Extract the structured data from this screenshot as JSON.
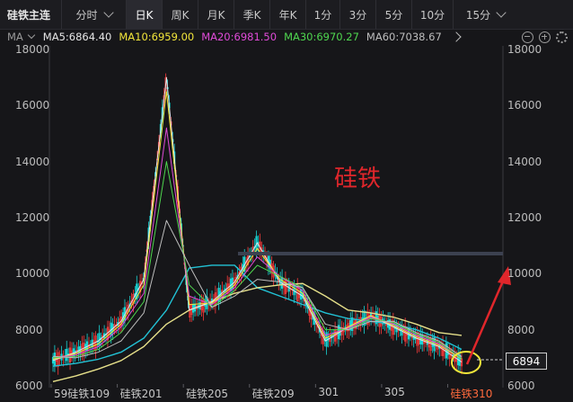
{
  "toolbar": {
    "title": "硅铁主连",
    "tabs": [
      "分时",
      "日K",
      "周K",
      "月K",
      "季K",
      "年K",
      "1分",
      "3分",
      "5分",
      "10分",
      "15分"
    ],
    "active_tab": "日K"
  },
  "ma_bar": {
    "label": "MA",
    "items": [
      {
        "text": "MA5:6864.40",
        "color": "#e6e6e6"
      },
      {
        "text": "MA10:6959.00",
        "color": "#f2e63a"
      },
      {
        "text": "MA20:6981.50",
        "color": "#e04bd8"
      },
      {
        "text": "MA30:6970.27",
        "color": "#4fd64f"
      },
      {
        "text": "MA60:7038.67",
        "color": "#bdbdbd"
      }
    ]
  },
  "y_axis": {
    "ticks": [
      "18000",
      "16000",
      "14000",
      "12000",
      "10000",
      "8000",
      "6000"
    ]
  },
  "x_axis": {
    "labels": [
      {
        "text": "59硅铁109",
        "color": "#c8c8c8"
      },
      {
        "text": "硅铁201",
        "color": "#c8c8c8"
      },
      {
        "text": "硅铁205",
        "color": "#c8c8c8"
      },
      {
        "text": "硅铁209",
        "color": "#c8c8c8"
      },
      {
        "text": "301",
        "color": "#c8c8c8"
      },
      {
        "text": "305",
        "color": "#c8c8c8"
      },
      {
        "text": "硅铁310",
        "color": "#ff6a3d"
      }
    ]
  },
  "current_price": "6894",
  "annotation": "硅铁",
  "chart_data": {
    "type": "line",
    "ylim": [
      6000,
      18000
    ],
    "series": [
      {
        "name": "MA5",
        "color": "#e6e6e6",
        "values": [
          6900,
          7200,
          7600,
          8300,
          9800,
          17000,
          8700,
          9000,
          9700,
          11100,
          9700,
          9200,
          7600,
          8100,
          8500,
          8100,
          7700,
          7400,
          6850
        ]
      },
      {
        "name": "MA10",
        "color": "#f2e63a",
        "values": [
          6950,
          7150,
          7500,
          8200,
          9600,
          16500,
          8900,
          8950,
          9600,
          10900,
          9800,
          9300,
          7700,
          8100,
          8500,
          8150,
          7750,
          7450,
          6960
        ]
      },
      {
        "name": "MA20",
        "color": "#e04bd8",
        "values": [
          7000,
          7100,
          7400,
          8100,
          9300,
          15200,
          9200,
          8900,
          9500,
          10600,
          9900,
          9400,
          7800,
          8050,
          8450,
          8200,
          7800,
          7500,
          6980
        ]
      },
      {
        "name": "MA30",
        "color": "#4fd64f",
        "values": [
          7000,
          7050,
          7300,
          7900,
          9000,
          14000,
          9600,
          8800,
          9400,
          10300,
          9900,
          9500,
          8000,
          8000,
          8400,
          8250,
          7850,
          7550,
          6970
        ]
      },
      {
        "name": "MA60",
        "color": "#bdbdbd",
        "values": [
          7050,
          7000,
          7200,
          7600,
          8600,
          11900,
          10300,
          8800,
          9200,
          9800,
          9700,
          9500,
          8200,
          8000,
          8300,
          8300,
          7900,
          7600,
          7040
        ]
      }
    ],
    "extra_lines": [
      {
        "name": "long-ma-cyan",
        "color": "#22c3d6",
        "values": [
          6700,
          6800,
          6950,
          7200,
          7700,
          8700,
          10200,
          10300,
          10300,
          9500,
          9200,
          8900,
          8600,
          8400,
          8300,
          8200,
          8000,
          7700,
          7300
        ]
      },
      {
        "name": "long-ma-yellow",
        "color": "#e6e08a",
        "values": [
          6150,
          6350,
          6600,
          6900,
          7400,
          8200,
          8700,
          9000,
          9300,
          9500,
          9600,
          9650,
          9200,
          8700,
          8600,
          8450,
          8200,
          7900,
          7800
        ]
      }
    ]
  }
}
